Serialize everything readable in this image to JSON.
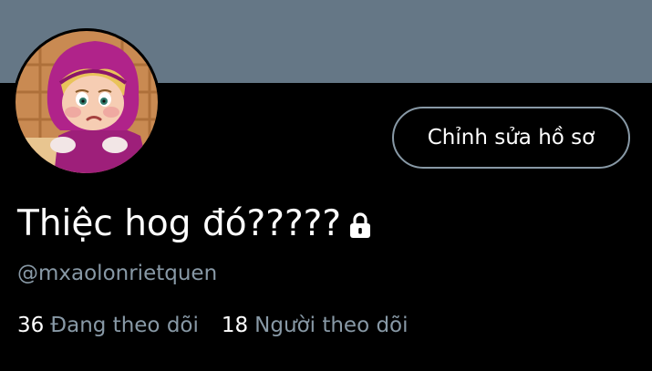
{
  "profile": {
    "display_name": "Thiệc hog đó?????",
    "handle": "@mxaolonrietquen",
    "edit_button_label": "Chỉnh sửa hồ sơ",
    "protected_icon": "lock-icon",
    "avatar_icon": "profile-avatar-cartoon-girl"
  },
  "stats": {
    "following": {
      "count": "36",
      "label": "Đang theo dõi"
    },
    "followers": {
      "count": "18",
      "label": "Người theo dõi"
    }
  },
  "colors": {
    "banner": "#657786",
    "background": "#000000",
    "text_primary": "#ffffff",
    "text_secondary": "#8899a6",
    "button_border": "#8899a6"
  }
}
